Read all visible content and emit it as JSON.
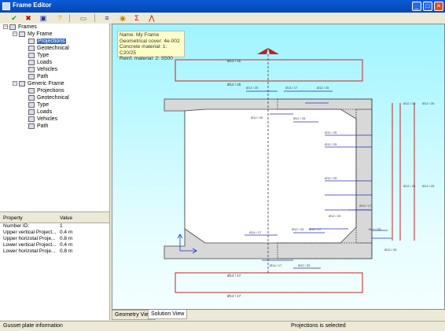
{
  "window": {
    "title": "Frame Editor",
    "min": "_",
    "max": "□",
    "close": "×"
  },
  "tree": {
    "root": "Frames",
    "frames": [
      {
        "name": "My Frame",
        "children": [
          "Projections",
          "Geotechnical",
          "Type",
          "Loads",
          "Vehicles",
          "Path"
        ]
      },
      {
        "name": "Generic Frame",
        "children": [
          "Projections",
          "Geotechnical",
          "Type",
          "Loads",
          "Vehicles",
          "Path"
        ]
      }
    ]
  },
  "properties": {
    "headers": [
      "Property",
      "Value"
    ],
    "rows": [
      [
        "Number ID:",
        "1"
      ],
      [
        "Upper vertical Project...",
        "0.4 m"
      ],
      [
        "Upper horizotal Proje...",
        "0.8 m"
      ],
      [
        "Lower vertical Project...",
        "0.4 m"
      ],
      [
        "Lower horizotal Proje...",
        "0.8 m"
      ]
    ]
  },
  "info_box": {
    "lines": [
      "Name: My Frame",
      "Geometrical cover: 4e-002",
      "Concrete material: 1: C20/25",
      "Reinf. material: 2: S500"
    ]
  },
  "drawing": {
    "rebar_small": "Ø12 / 25",
    "rebar_medium": "Ø14 / 17",
    "rebar_top": "Ø12 / 25",
    "rebar_bottom": "Ø14 / 17",
    "rebar_right": "Ø12 / 25"
  },
  "tabs": [
    "Geometry View",
    "Solution View"
  ],
  "status": {
    "left": "Gusset plate information",
    "right": "Projections is selected"
  }
}
